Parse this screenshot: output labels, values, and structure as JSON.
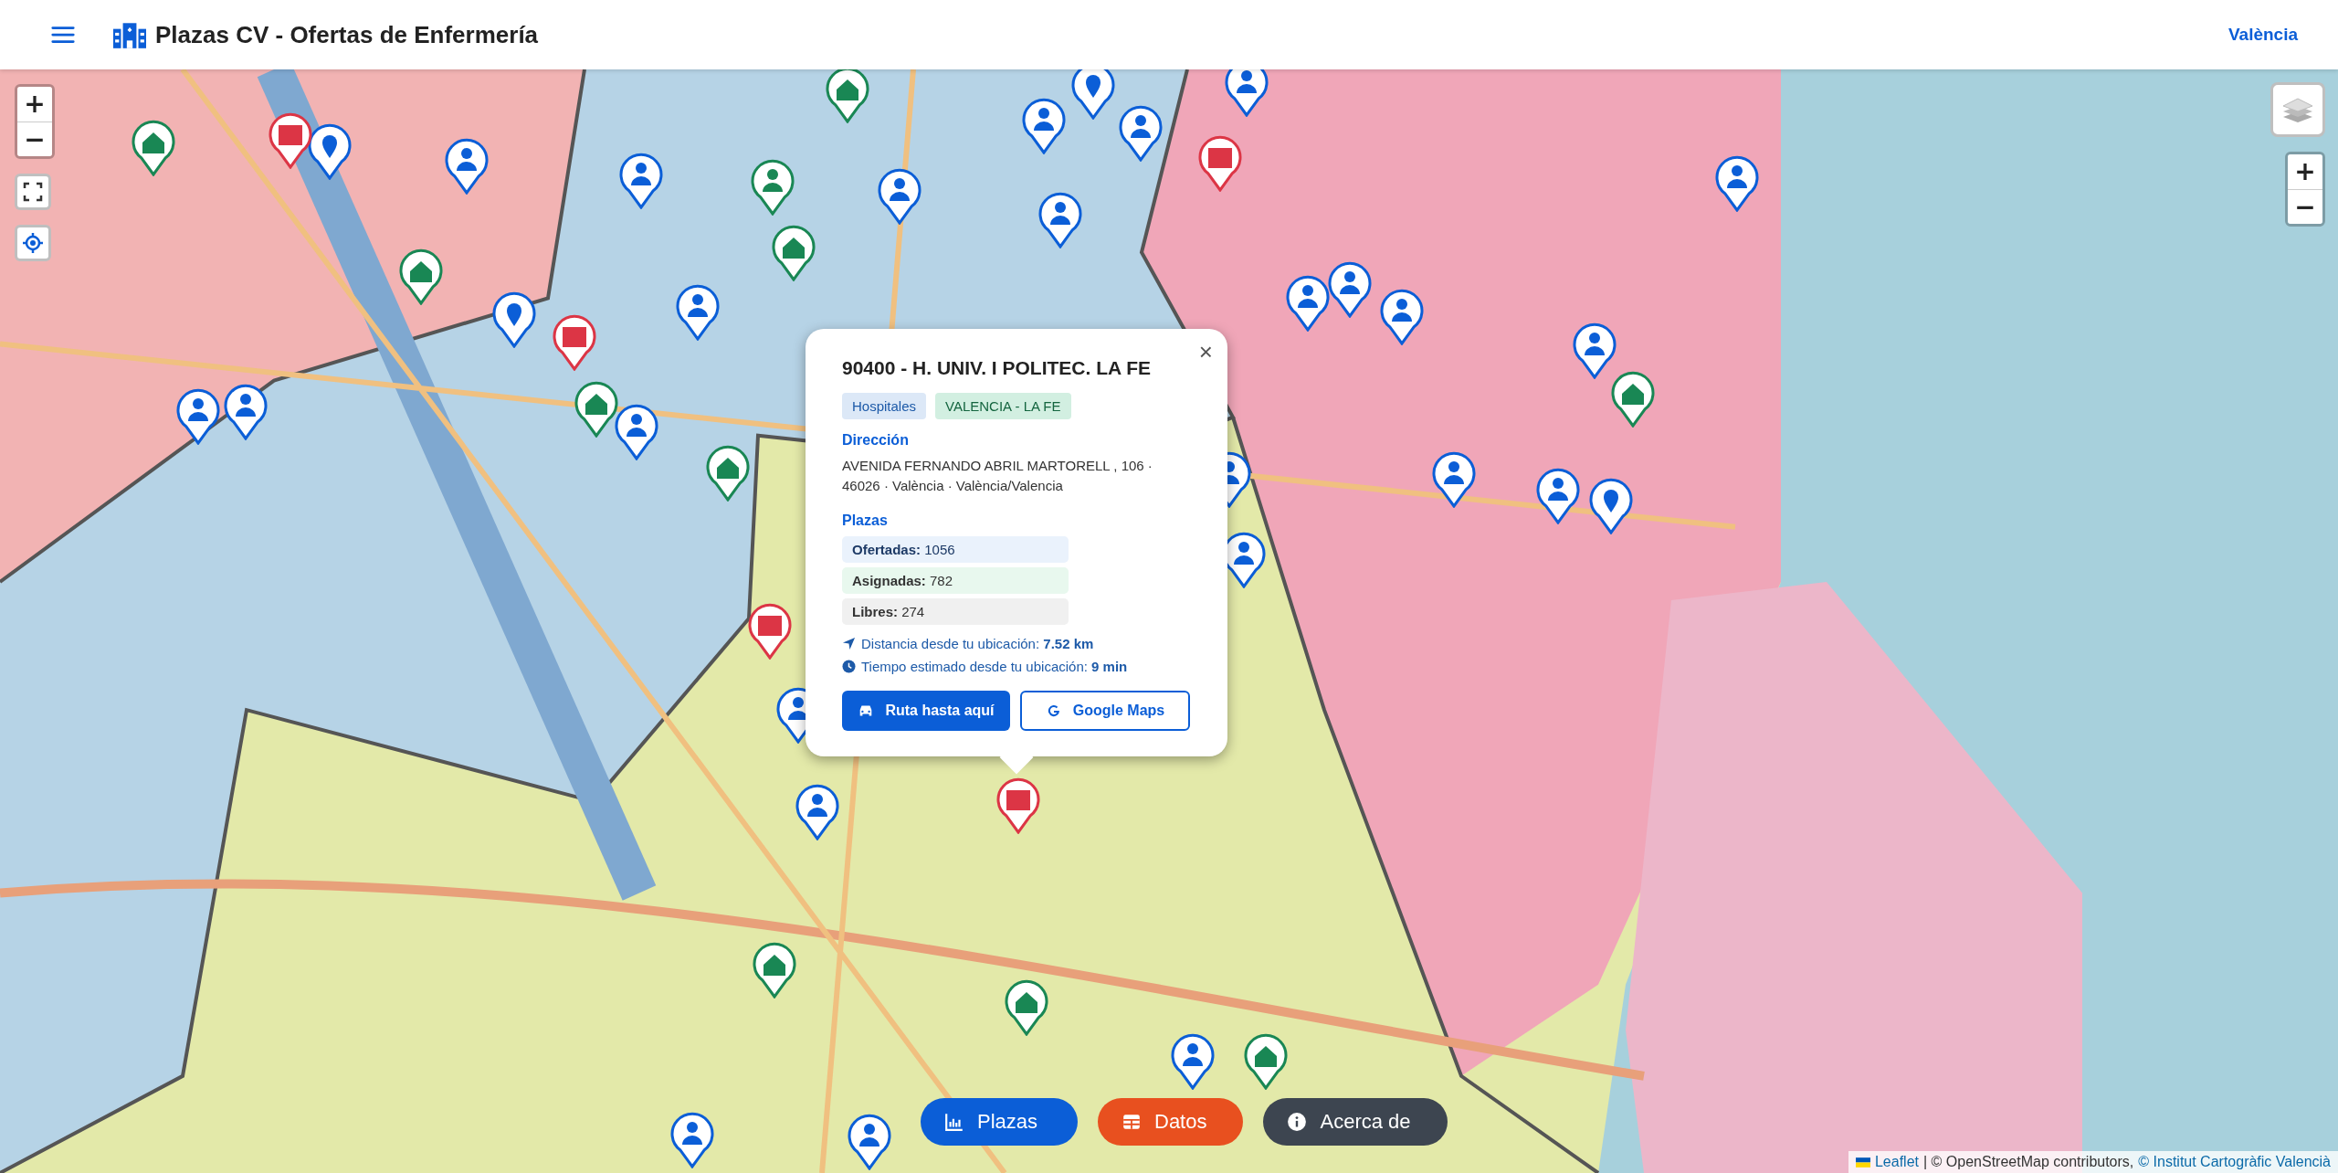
{
  "header": {
    "title": "Plazas CV - Ofertas de Enfermería",
    "location_link": "València"
  },
  "zoom_left": {
    "zoom_in": "+",
    "zoom_out": "−"
  },
  "zoom_right": {
    "zoom_in": "+",
    "zoom_out": "−"
  },
  "popup": {
    "close": "×",
    "title": "90400 - H. UNIV. I POLITEC. LA FE",
    "tags": [
      {
        "label": "Hospitales",
        "kind": "type"
      },
      {
        "label": "VALENCIA - LA FE",
        "kind": "zone"
      }
    ],
    "address_heading": "Dirección",
    "address": "AVENIDA FERNANDO ABRIL MARTORELL , 106 · 46026 · València · València/Valencia",
    "plazas_heading": "Plazas",
    "stats": [
      {
        "label": "Ofertadas:",
        "value": "1056",
        "kind": "offered"
      },
      {
        "label": "Asignadas:",
        "value": "782",
        "kind": "assigned"
      },
      {
        "label": "Libres:",
        "value": "274",
        "kind": "free"
      }
    ],
    "distance": {
      "label": "Distancia desde tu ubicación:",
      "value": "7.52 km"
    },
    "time": {
      "label": "Tiempo estimado desde tu ubicación:",
      "value": "9 min"
    },
    "buttons": [
      {
        "label": "Ruta hasta aquí",
        "kind": "primary"
      },
      {
        "label": "Google Maps",
        "kind": "outline"
      }
    ]
  },
  "bottom_buttons": [
    {
      "label": "Plazas",
      "kind": "chart"
    },
    {
      "label": "Datos",
      "kind": "table"
    },
    {
      "label": "Acerca de",
      "kind": "info"
    }
  ],
  "attribution": {
    "leaflet": "Leaflet",
    "text": "| © OpenStreetMap contributors,",
    "provider": "© Institut Cartogràfic Valencià"
  }
}
